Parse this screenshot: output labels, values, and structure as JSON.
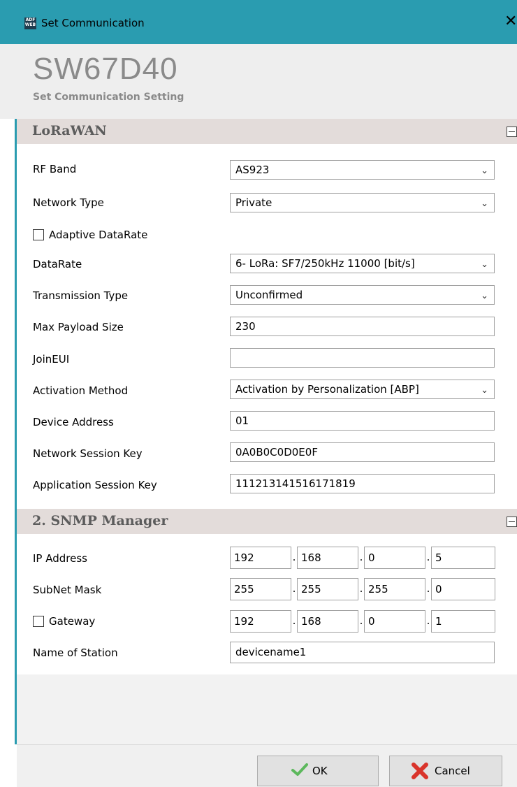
{
  "window": {
    "title": "Set Communication",
    "icon_text": "ADF WEB",
    "close_glyph": "✕"
  },
  "header": {
    "title": "SW67D40",
    "subtitle": "Set Communication Setting"
  },
  "lorawan": {
    "section_title": "LoRaWAN",
    "rf_band": {
      "label": "RF Band",
      "value": "AS923"
    },
    "network_type": {
      "label": "Network Type",
      "value": "Private"
    },
    "adaptive_datarate": {
      "label": "Adaptive DataRate",
      "checked": false
    },
    "datarate": {
      "label": "DataRate",
      "value": "6- LoRa: SF7/250kHz 11000 [bit/s]"
    },
    "transmission_type": {
      "label": "Transmission Type",
      "value": "Unconfirmed"
    },
    "max_payload_size": {
      "label": "Max Payload Size",
      "value": "230"
    },
    "join_eui": {
      "label": "JoinEUI",
      "value": ""
    },
    "activation_method": {
      "label": "Activation Method",
      "value": "Activation by Personalization [ABP]"
    },
    "device_address": {
      "label": "Device Address",
      "value": "01"
    },
    "network_session_key": {
      "label": "Network Session Key",
      "value": "0A0B0C0D0E0F"
    },
    "application_session_key": {
      "label": "Application Session Key",
      "value": "111213141516171819"
    }
  },
  "snmp": {
    "section_title": "2. SNMP Manager",
    "ip_address": {
      "label": "IP Address",
      "octets": [
        "192",
        "168",
        "0",
        "5"
      ]
    },
    "subnet_mask": {
      "label": "SubNet Mask",
      "octets": [
        "255",
        "255",
        "255",
        "0"
      ]
    },
    "gateway": {
      "label": "Gateway",
      "checked": false,
      "octets": [
        "192",
        "168",
        "0",
        "1"
      ]
    },
    "name_of_station": {
      "label": "Name of Station",
      "value": "devicename1"
    },
    "dot": "."
  },
  "buttons": {
    "ok": "OK",
    "cancel": "Cancel"
  },
  "icons": {
    "chevron": "chevron-down-icon",
    "ok": "check-icon",
    "cancel": "cross-icon"
  },
  "colors": {
    "titlebar": "#2a9cb0",
    "section_bar": "#e3dcda",
    "header_text": "#8a8a8a"
  }
}
